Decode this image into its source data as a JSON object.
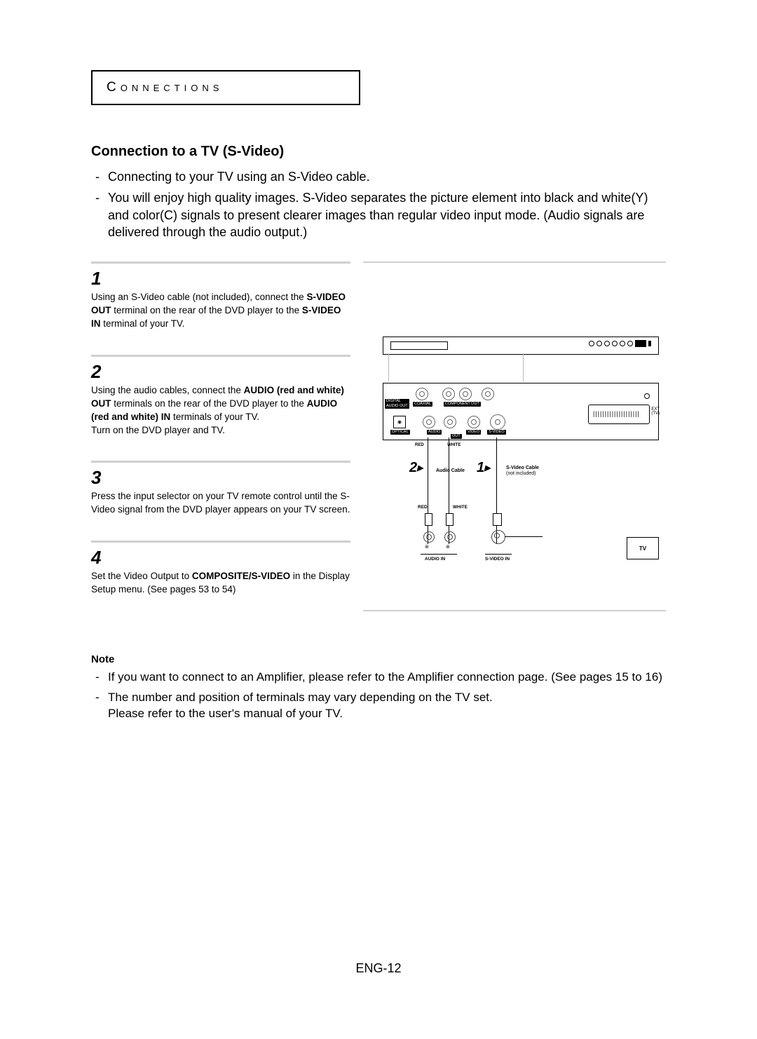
{
  "header_label": "Connections",
  "section_title": "Connection to a TV (S-Video)",
  "intro_bullets": [
    "Connecting to your TV using an S-Video cable.",
    "You will enjoy high quality images. S-Video separates the picture element into black and white(Y) and color(C) signals to present clearer images than regular video input mode. (Audio signals are delivered through the audio output.)"
  ],
  "steps": [
    {
      "num": "1",
      "segments": [
        {
          "t": "Using an S-Video cable (not included), connect the "
        },
        {
          "t": "S-VIDEO OUT",
          "b": true
        },
        {
          "t": " terminal on the rear of the DVD player to the "
        },
        {
          "t": "S-VIDEO IN",
          "b": true
        },
        {
          "t": " terminal of your TV."
        }
      ]
    },
    {
      "num": "2",
      "segments": [
        {
          "t": "Using the audio cables, connect the "
        },
        {
          "t": "AUDIO (red and white) OUT",
          "b": true
        },
        {
          "t": " terminals on the rear of the DVD player to the "
        },
        {
          "t": "AUDIO (red and white) IN",
          "b": true
        },
        {
          "t": " terminals of your TV."
        },
        {
          "br": true
        },
        {
          "t": "Turn on the DVD player and TV."
        }
      ]
    },
    {
      "num": "3",
      "segments": [
        {
          "t": "Press the input selector on your TV remote control until the S-Video signal from the DVD player appears on your TV screen."
        }
      ]
    },
    {
      "num": "4",
      "segments": [
        {
          "t": "Set the Video Output to "
        },
        {
          "t": "COMPOSITE/S-VIDEO",
          "b": true
        },
        {
          "t": " in the Display Setup menu. (See pages 53 to 54)"
        }
      ]
    }
  ],
  "diagram": {
    "panel_labels": {
      "digital_audio_out": "DIGITAL\nAUDIO OUT",
      "coaxial": "COAXIAL",
      "component_out": "COMPONENT OUT",
      "optical": "OPTICAL",
      "audio": "AUDIO",
      "out": "OUT",
      "video": "VIDEO",
      "svideo": "S-VIDEO",
      "ext": "EXT\n(TV)",
      "red": "RED",
      "white": "WHITE"
    },
    "callout_2": "2",
    "callout_2_label": "Audio Cable",
    "callout_1": "1",
    "callout_1_label_a": "S-Video Cable",
    "callout_1_label_b": "(not included)",
    "bottom_red": "RED",
    "bottom_white": "WHITE",
    "tv_label": "TV",
    "audio_in": "AUDIO IN",
    "svideo_in": "S-VIDEO IN"
  },
  "notes_title": "Note",
  "notes": [
    "If you want to connect to an Amplifier, please refer to the Amplifier connection page. (See pages 15 to 16)",
    "The number and position of terminals may vary depending on the TV set.\nPlease refer to the user's manual of your TV."
  ],
  "page_number": "ENG-12"
}
